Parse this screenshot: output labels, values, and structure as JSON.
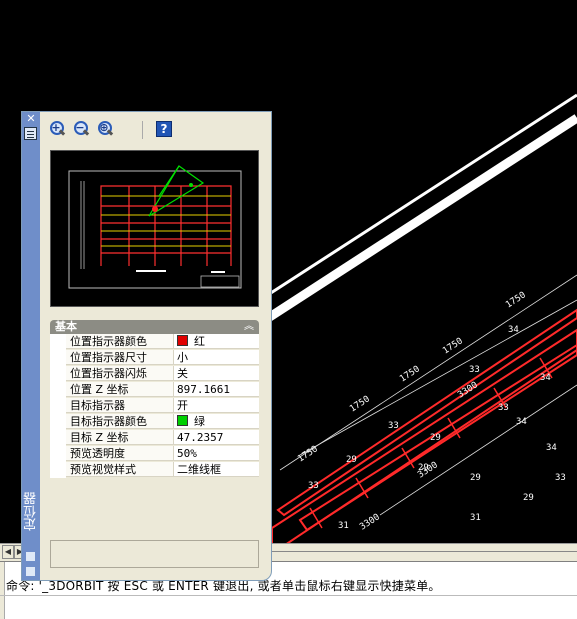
{
  "palette": {
    "title": "定位器",
    "toolbar": {
      "zoom_in_icon": "zoom-in-icon",
      "zoom_out_icon": "zoom-out-icon",
      "zoom_extents_icon": "zoom-extents-icon",
      "help_icon": "help-icon",
      "help_glyph": "?"
    },
    "section_title": "基本",
    "collapse_glyph": "︽",
    "properties": [
      {
        "name": "位置指示器颜色",
        "value": "红",
        "swatch": "#e00000"
      },
      {
        "name": "位置指示器尺寸",
        "value": "小"
      },
      {
        "name": "位置指示器闪烁",
        "value": "关"
      },
      {
        "name": "位置 Z 坐标",
        "value": "897.1661"
      },
      {
        "name": "目标指示器",
        "value": "开"
      },
      {
        "name": "目标指示器颜色",
        "value": "绿",
        "swatch": "#00d000"
      },
      {
        "name": "目标 Z 坐标",
        "value": "47.2357"
      },
      {
        "name": "预览透明度",
        "value": "50%"
      },
      {
        "name": "预览视觉样式",
        "value": "二维线框"
      }
    ]
  },
  "drawing": {
    "labels": [
      "1750",
      "34",
      "1750",
      "34",
      "1750",
      "33",
      "1750",
      "33",
      "34",
      "3300",
      "33",
      "34",
      "29",
      "1750",
      "3300",
      "33",
      "29",
      "33",
      "29",
      "31",
      "3300",
      "29",
      "29",
      "31"
    ]
  },
  "command": {
    "text": "命令: '_3DORBIT 按 ESC 或 ENTER 键退出, 或者单击鼠标右键显示快捷菜单。"
  },
  "colors": {
    "background": "#000000",
    "palette_bg": "#ece9d8",
    "titlebar": "#6f8ec9",
    "structure": "#ff2a2a"
  }
}
